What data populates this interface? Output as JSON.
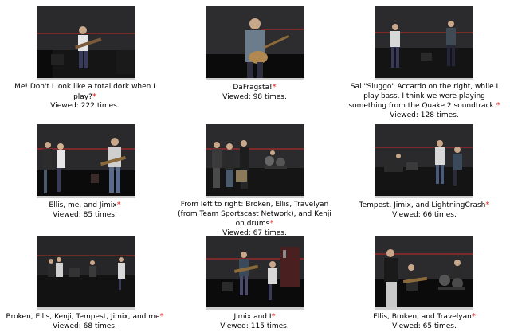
{
  "gallery": {
    "viewed_prefix": "Viewed: ",
    "viewed_suffix": " times.",
    "star_symbol": "*",
    "star_color": "#e01b1b",
    "items": [
      {
        "caption": "Me! Don't I look like a total dork when I play?",
        "views": "222"
      },
      {
        "caption": "DaFragsta!",
        "views": "98"
      },
      {
        "caption": "Sal \"Sluggo\" Accardo on the right, while I play bass. I think we were playing something from the Quake 2 soundtrack.",
        "views": "128"
      },
      {
        "caption": "Ellis, me, and Jimix",
        "views": "85"
      },
      {
        "caption": "From left to right: Broken, Ellis, Travelyan (from Team Sportscast Network), and Kenji on drums",
        "views": "67"
      },
      {
        "caption": "Tempest, Jimix, and LightningCrash",
        "views": "66"
      },
      {
        "caption": "Broken, Ellis, Kenji, Tempest, Jimix, and me",
        "views": "68"
      },
      {
        "caption": "Jimix and I",
        "views": "115"
      },
      {
        "caption": "Ellis, Broken, and Travelyan",
        "views": "65"
      }
    ]
  }
}
